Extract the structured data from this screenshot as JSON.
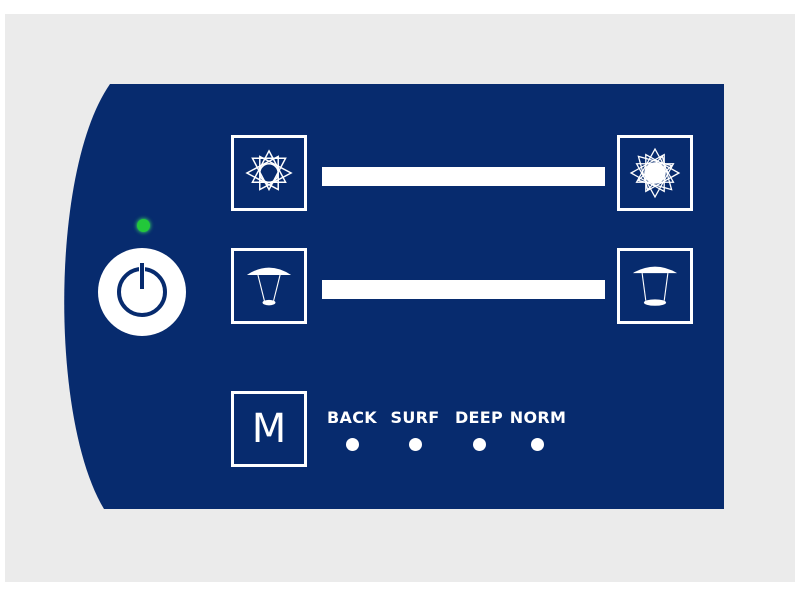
{
  "panel": {
    "background_color": "#072b6e",
    "frame_color": "#ebebeb",
    "led_color": "#22c83a"
  },
  "power": {
    "icon": "power-icon",
    "led_state": "on"
  },
  "controls": {
    "light_down_icon": "sun-dim-icon",
    "light_up_icon": "sun-bright-icon",
    "lamp_down_icon": "lamp-low-icon",
    "lamp_up_icon": "lamp-high-icon"
  },
  "mode": {
    "button_label": "M",
    "options": [
      "BACK",
      "SURF",
      "DEEP",
      "NORM"
    ]
  }
}
